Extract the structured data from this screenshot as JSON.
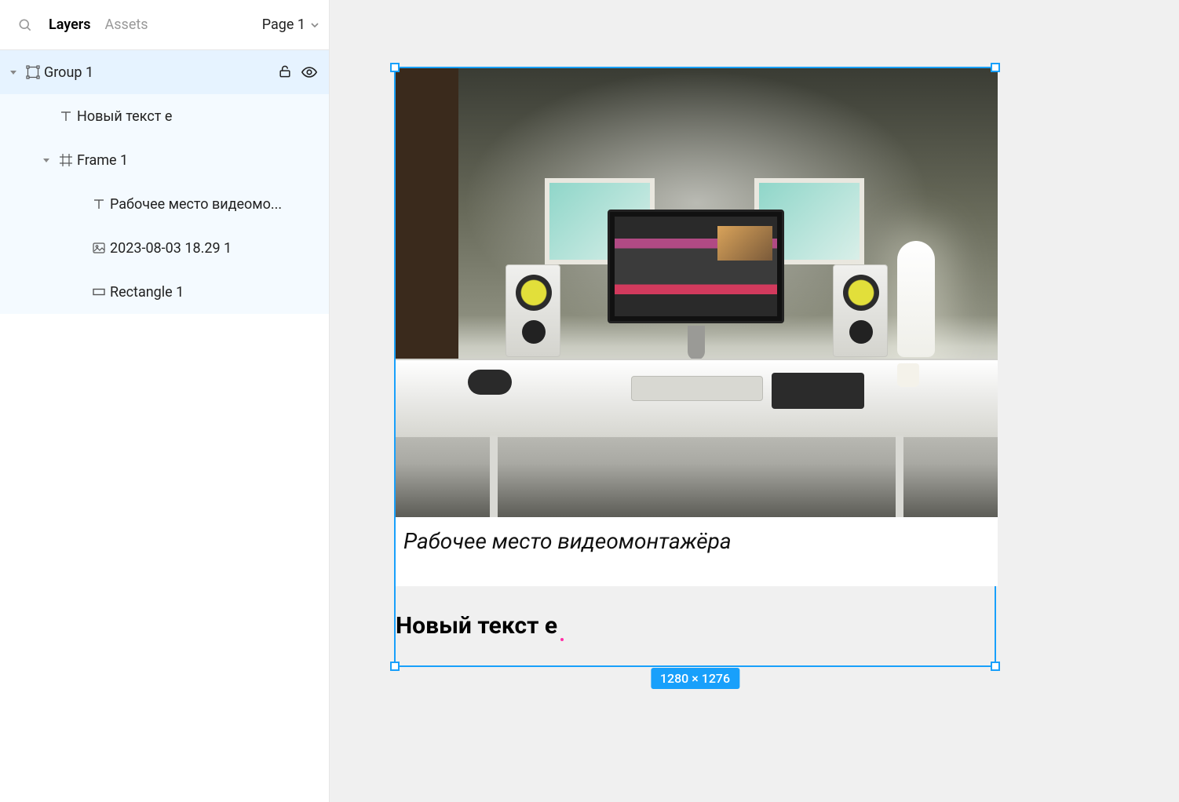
{
  "panel": {
    "tabs": {
      "layers": "Layers",
      "assets": "Assets"
    },
    "page_selector": "Page 1"
  },
  "layers": [
    {
      "id": "group1",
      "label": "Group 1",
      "depth": 0,
      "kind": "group",
      "expanded": true,
      "selected": true
    },
    {
      "id": "text1",
      "label": "Новый текст е",
      "depth": 1,
      "kind": "text",
      "expanded": null,
      "selected": false
    },
    {
      "id": "frame1",
      "label": "Frame 1",
      "depth": 1,
      "kind": "frame",
      "expanded": true,
      "selected": false
    },
    {
      "id": "text2",
      "label": "Рабочее место видеомо...",
      "depth": 2,
      "kind": "text",
      "expanded": null,
      "selected": false
    },
    {
      "id": "img1",
      "label": "2023-08-03 18.29 1",
      "depth": 2,
      "kind": "image",
      "expanded": null,
      "selected": false
    },
    {
      "id": "rect1",
      "label": "Rectangle 1",
      "depth": 2,
      "kind": "rect",
      "expanded": null,
      "selected": false
    }
  ],
  "canvas": {
    "caption_text": "Рабочее место видеомонтажёра",
    "below_text": "Новый текст е",
    "selection_size": "1280 × 1276"
  }
}
